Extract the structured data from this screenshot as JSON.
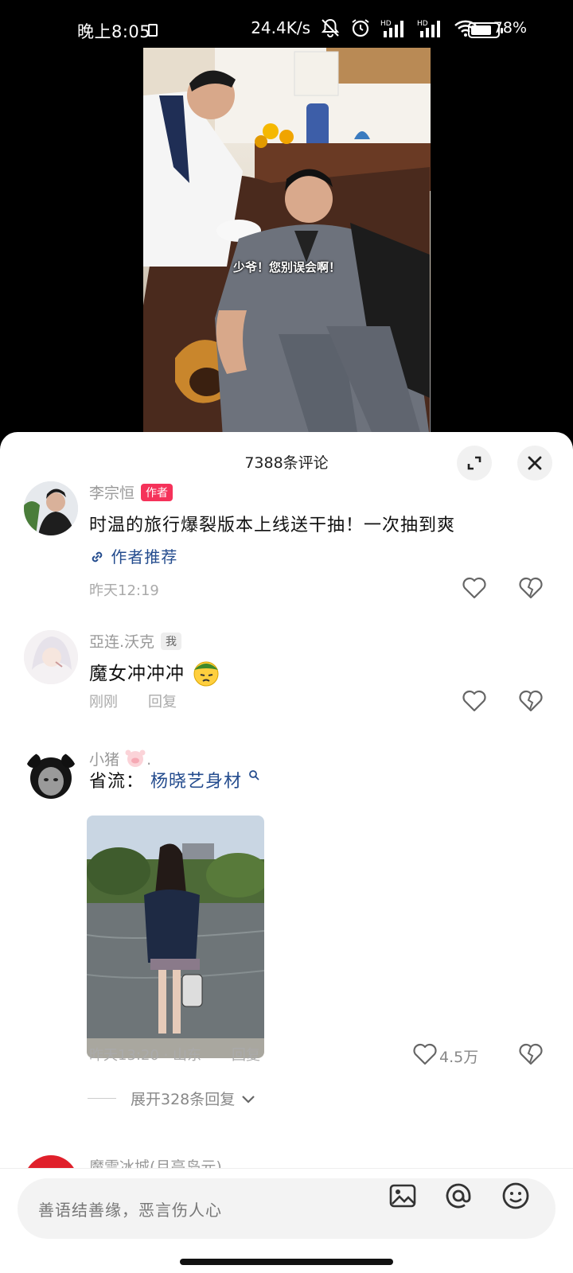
{
  "status_bar": {
    "time": "晚上8:05",
    "network_speed": "24.4K/s",
    "signal_label": "HD",
    "battery_pct": "78",
    "battery_level": 0.78
  },
  "video": {
    "caption": "少爷！您别误会啊！"
  },
  "sheet": {
    "title": "7388条评论",
    "expand_icon": "expand-icon",
    "close_icon": "close-icon"
  },
  "comments": [
    {
      "username": "李宗恒",
      "tag": "作者",
      "text": "时温的旅行爆裂版本上线送干抽！一次抽到爽",
      "link": "作者推荐",
      "time": "昨天12:19"
    },
    {
      "username": "亞连.沃克",
      "tag": "我",
      "text": "魔女冲冲冲",
      "time": "刚刚",
      "reply": "回复"
    },
    {
      "username": "小猪",
      "text_prefix": "省流：",
      "text_link": "杨晓艺身材",
      "time": "昨天13:20 · 山东",
      "reply": "回复",
      "likes": "4.5万"
    }
  ],
  "expand_replies": "展开328条回复",
  "next_comment_username": "魔雪冰城(月亮岛元)",
  "input": {
    "placeholder": "善语结善缘，恶言伤人心"
  }
}
